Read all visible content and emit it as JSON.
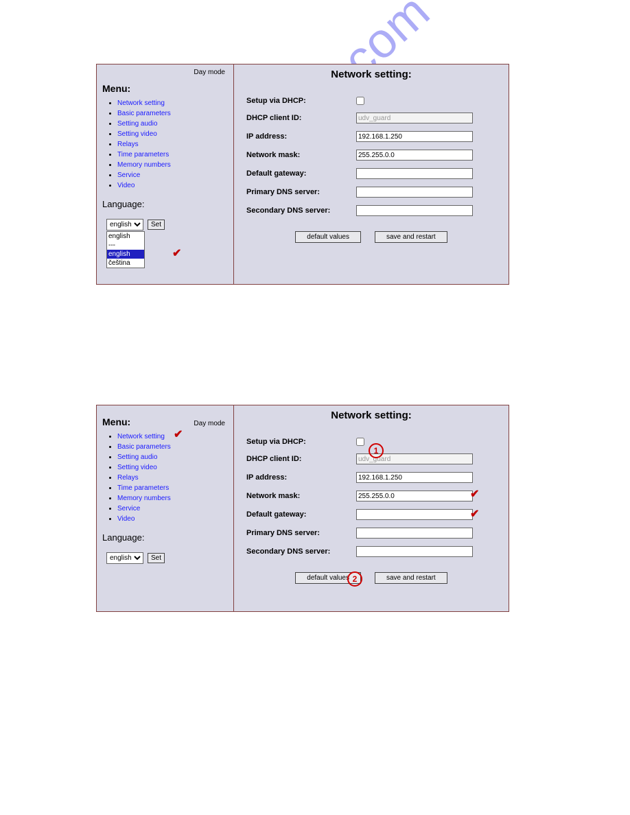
{
  "watermark": "manualshive.com",
  "annotations": {
    "circle1": "1",
    "circle2": "2"
  },
  "panel1": {
    "daymode": "Day mode",
    "menu_heading": "Menu:",
    "menu_items": [
      "Network setting",
      "Basic parameters",
      "Setting audio",
      "Setting video",
      "Relays",
      "Time parameters",
      "Memory numbers",
      "Service",
      "Video"
    ],
    "language_heading": "Language:",
    "lang_selected": "english",
    "set_button": "Set",
    "lang_options": [
      "english",
      "---",
      "english",
      "čeština"
    ],
    "title": "Network setting:",
    "labels": {
      "dhcp": "Setup via DHCP:",
      "dhcp_client": "DHCP client ID:",
      "ip": "IP address:",
      "mask": "Network mask:",
      "gw": "Default gateway:",
      "dns1": "Primary DNS server:",
      "dns2": "Secondary DNS server:"
    },
    "values": {
      "dhcp_client": "udv_guard",
      "ip": "192.168.1.250",
      "mask": "255.255.0.0",
      "gw": "",
      "dns1": "",
      "dns2": ""
    },
    "buttons": {
      "defaults": "default values",
      "save": "save and restart"
    }
  },
  "panel2": {
    "daymode": "Day mode",
    "menu_heading": "Menu:",
    "menu_items": [
      "Network setting",
      "Basic parameters",
      "Setting audio",
      "Setting video",
      "Relays",
      "Time parameters",
      "Memory numbers",
      "Service",
      "Video"
    ],
    "language_heading": "Language:",
    "lang_selected": "english",
    "set_button": "Set",
    "title": "Network setting:",
    "labels": {
      "dhcp": "Setup via DHCP:",
      "dhcp_client": "DHCP client ID:",
      "ip": "IP address:",
      "mask": "Network mask:",
      "gw": "Default gateway:",
      "dns1": "Primary DNS server:",
      "dns2": "Secondary DNS server:"
    },
    "values": {
      "dhcp_client": "udv_guard",
      "ip": "192.168.1.250",
      "mask": "255.255.0.0",
      "gw": "",
      "dns1": "",
      "dns2": ""
    },
    "buttons": {
      "defaults": "default values",
      "save": "save and restart"
    }
  }
}
